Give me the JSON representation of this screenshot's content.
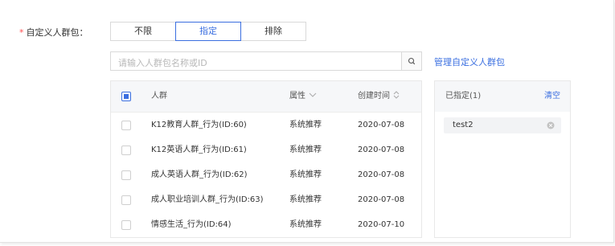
{
  "form": {
    "required_mark": "*",
    "label": "自定义人群包："
  },
  "segment": {
    "options": [
      "不限",
      "指定",
      "排除"
    ],
    "selected": "指定"
  },
  "search": {
    "placeholder": "请输入人群包名称或ID",
    "button_icon": "search-icon"
  },
  "manage_link": "管理自定义人群包",
  "table": {
    "headers": {
      "name": "人群",
      "attribute": "属性",
      "created": "创建时间"
    },
    "rows": [
      {
        "name": "K12教育人群_行为(ID:60)",
        "attribute": "系统推荐",
        "created": "2020-07-08"
      },
      {
        "name": "K12英语人群_行为(ID:61)",
        "attribute": "系统推荐",
        "created": "2020-07-08"
      },
      {
        "name": "成人英语人群_行为(ID:62)",
        "attribute": "系统推荐",
        "created": "2020-07-08"
      },
      {
        "name": "成人职业培训人群_行为(ID:63)",
        "attribute": "系统推荐",
        "created": "2020-07-08"
      },
      {
        "name": "情感生活_行为(ID:64)",
        "attribute": "系统推荐",
        "created": "2020-07-10"
      }
    ]
  },
  "selected_panel": {
    "title": "已指定(1)",
    "clear": "清空",
    "items": [
      "test2"
    ]
  },
  "colors": {
    "accent": "#3b6fe0",
    "required": "#ff4d4f",
    "border": "#d9d9d9",
    "header_bg": "#f6f7f9"
  }
}
